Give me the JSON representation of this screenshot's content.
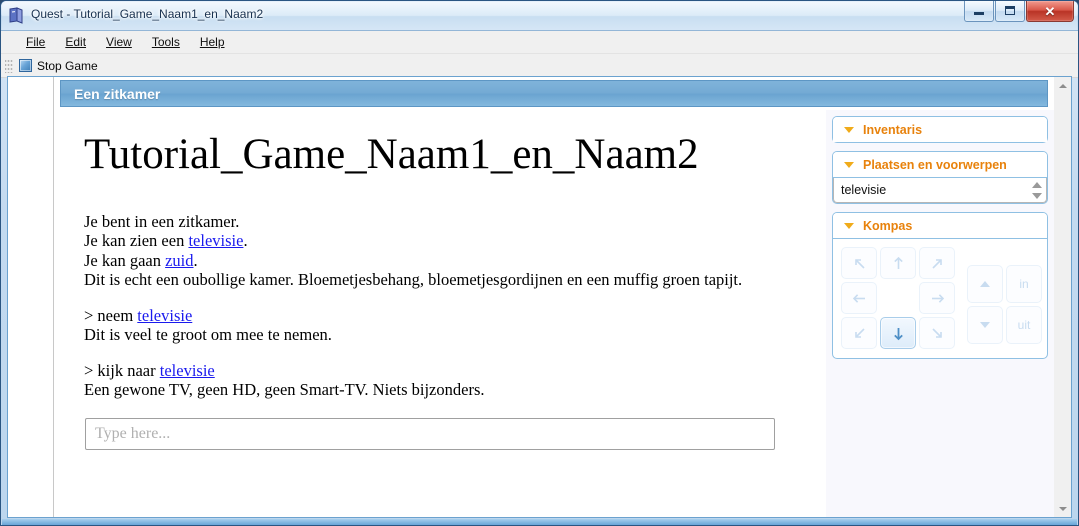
{
  "window": {
    "title": "Quest - Tutorial_Game_Naam1_en_Naam2",
    "app_icon": "quest-app-icon",
    "buttons": {
      "minimize": "minimize-button",
      "maximize": "maximize-button",
      "close_glyph": "✕"
    }
  },
  "menubar": {
    "items": [
      {
        "label": "File",
        "accel": "F"
      },
      {
        "label": "Edit",
        "accel": "E"
      },
      {
        "label": "View",
        "accel": "V"
      },
      {
        "label": "Tools",
        "accel": "T"
      },
      {
        "label": "Help",
        "accel": "H"
      }
    ]
  },
  "toolbar": {
    "stop_game_label": "Stop Game"
  },
  "room": {
    "header": "Een zitkamer",
    "game_title": "Tutorial_Game_Naam1_en_Naam2"
  },
  "transcript": [
    {
      "id": "room-description",
      "lines": [
        {
          "parts": [
            {
              "t": "Je bent in een zitkamer."
            }
          ]
        },
        {
          "parts": [
            {
              "t": "Je kan zien een "
            },
            {
              "t": "televisie",
              "link": true
            },
            {
              "t": "."
            }
          ]
        },
        {
          "parts": [
            {
              "t": "Je kan gaan "
            },
            {
              "t": "zuid",
              "link": true
            },
            {
              "t": "."
            }
          ]
        },
        {
          "parts": [
            {
              "t": "Dit is echt een oubollige kamer. Bloemetjesbehang, bloemetjesgordijnen en een muffig groen tapijt."
            }
          ]
        }
      ]
    },
    {
      "id": "command-take",
      "lines": [
        {
          "parts": [
            {
              "t": "> neem "
            },
            {
              "t": "televisie",
              "link": true
            }
          ]
        },
        {
          "parts": [
            {
              "t": "Dit is veel te groot om mee te nemen."
            }
          ]
        }
      ]
    },
    {
      "id": "command-look",
      "lines": [
        {
          "parts": [
            {
              "t": "> kijk naar "
            },
            {
              "t": "televisie",
              "link": true
            }
          ]
        },
        {
          "parts": [
            {
              "t": "Een gewone TV, geen HD, geen Smart-TV. Niets bijzonders."
            }
          ]
        }
      ]
    }
  ],
  "command_input": {
    "value": "",
    "placeholder": "Type here..."
  },
  "panels": {
    "inventory": {
      "title": "Inventaris",
      "items": []
    },
    "places_objects": {
      "title": "Plaatsen en voorwerpen",
      "items": [
        "televisie"
      ]
    },
    "compass": {
      "title": "Kompas",
      "grid": [
        {
          "name": "northwest",
          "glyph": "arrow-nw",
          "enabled": false
        },
        {
          "name": "north",
          "glyph": "arrow-n",
          "enabled": false
        },
        {
          "name": "northeast",
          "glyph": "arrow-ne",
          "enabled": false
        },
        {
          "name": "west",
          "glyph": "arrow-w",
          "enabled": false
        },
        {
          "name": "center",
          "glyph": "none",
          "enabled": false
        },
        {
          "name": "east",
          "glyph": "arrow-e",
          "enabled": false
        },
        {
          "name": "southwest",
          "glyph": "arrow-sw",
          "enabled": false
        },
        {
          "name": "south",
          "glyph": "arrow-s",
          "enabled": true
        },
        {
          "name": "southeast",
          "glyph": "arrow-se",
          "enabled": false
        }
      ],
      "extra": [
        {
          "name": "up",
          "label": "",
          "glyph": "tri-up",
          "enabled": false
        },
        {
          "name": "in",
          "label": "in",
          "glyph": "text",
          "enabled": false
        },
        {
          "name": "down",
          "label": "",
          "glyph": "tri-down",
          "enabled": false
        },
        {
          "name": "out",
          "label": "uit",
          "glyph": "text",
          "enabled": false
        }
      ]
    }
  },
  "colors": {
    "header_blue": "#74aad4",
    "panel_title_orange": "#e8820c",
    "link_blue": "#1a1aee",
    "caret_orange": "#f0ab1a"
  }
}
